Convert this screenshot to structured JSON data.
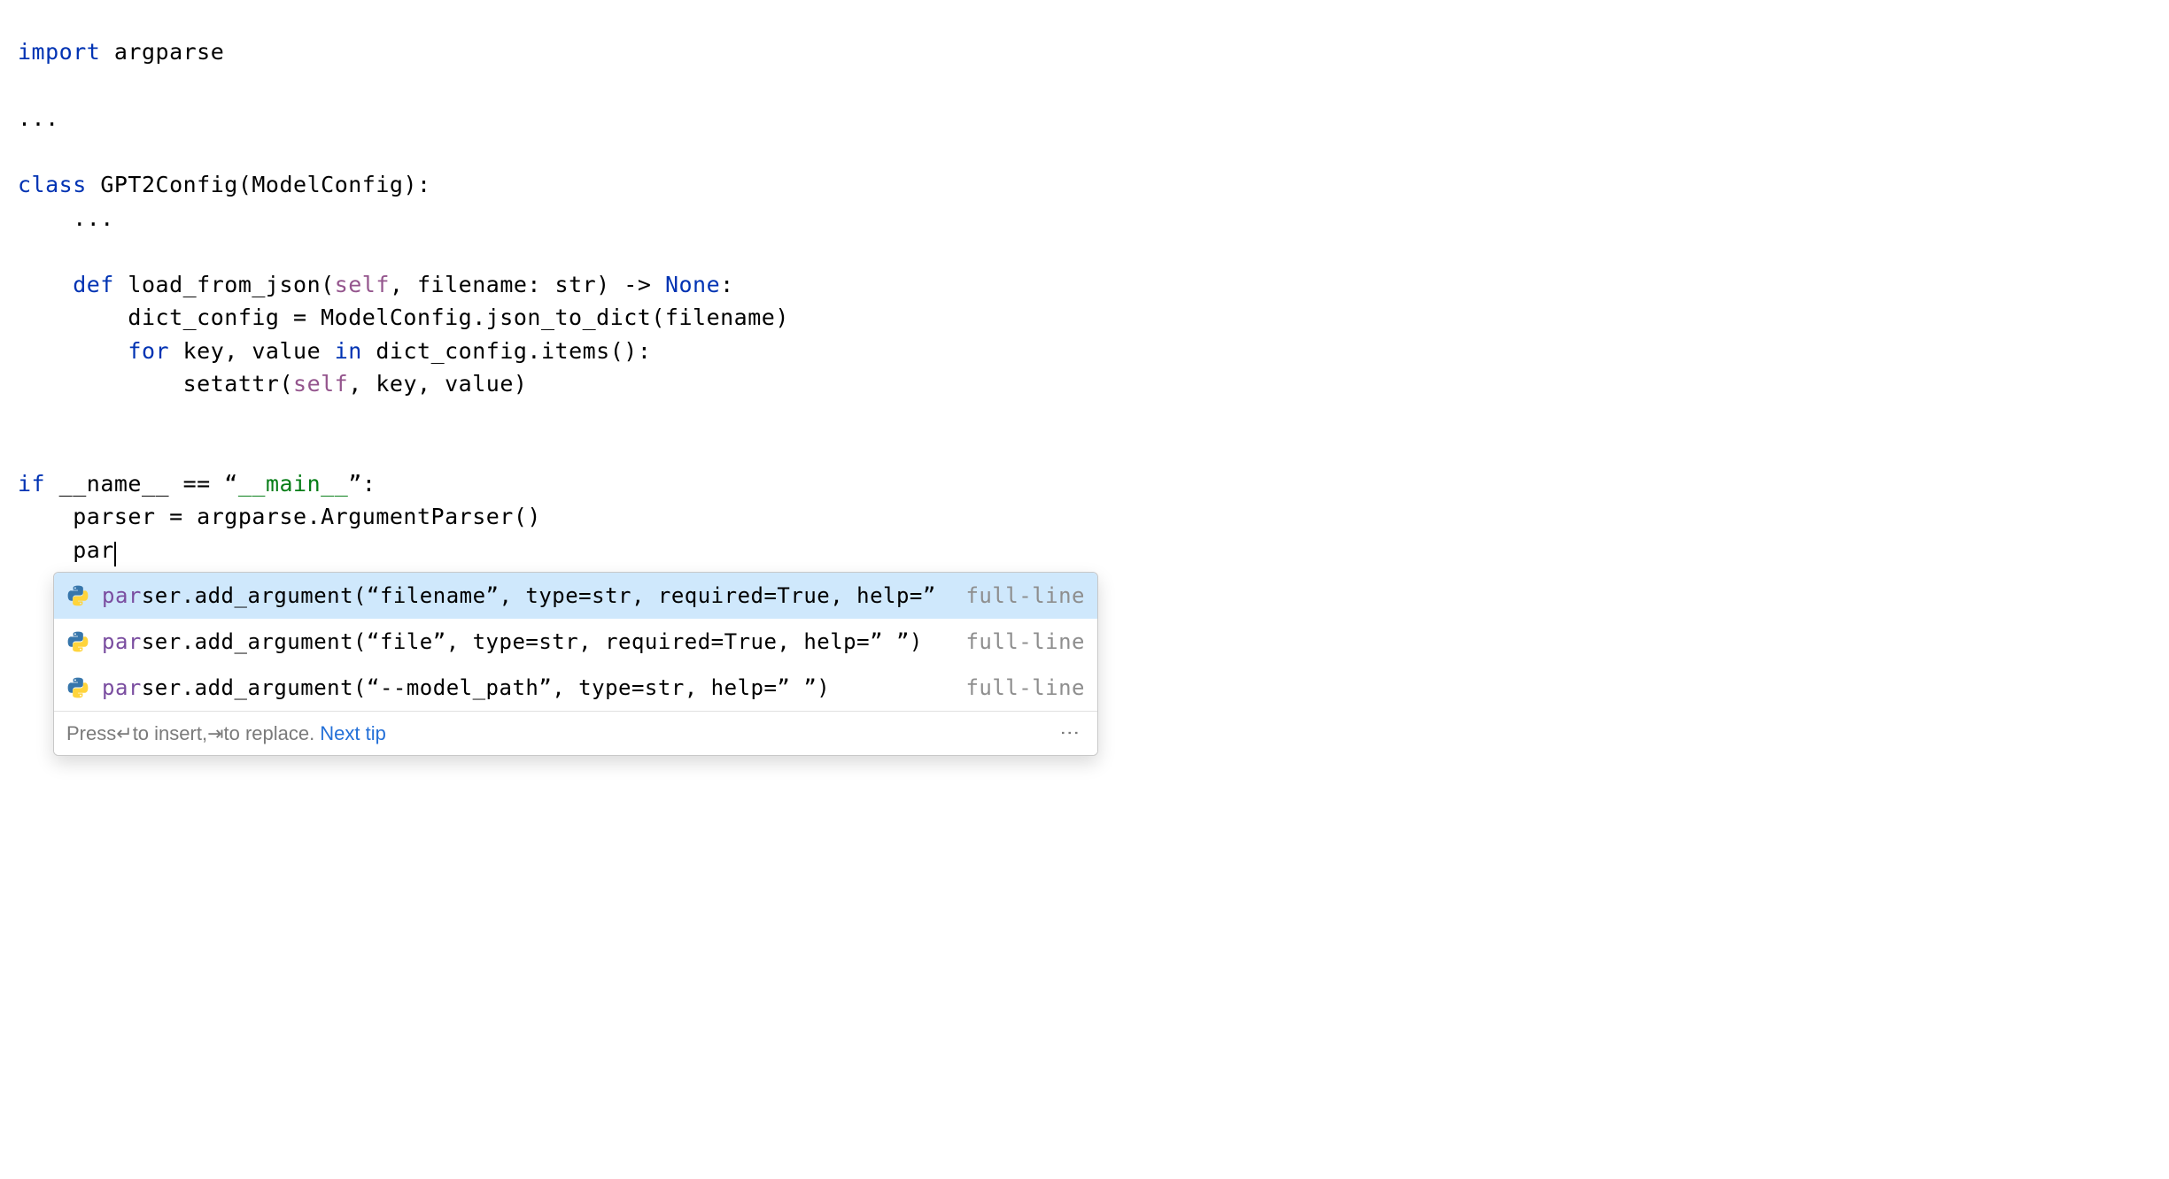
{
  "code": {
    "line1_import": "import",
    "line1_module": " argparse",
    "line3_ellipsis": "...",
    "line5_class": "class",
    "line5_rest": " GPT2Config(ModelConfig):",
    "line6_ellipsis": "    ...",
    "line8_def": "    def",
    "line8_name": " load_from_json(",
    "line8_self": "self",
    "line8_rest1": ", filename: str) -> ",
    "line8_none": "None",
    "line8_rest2": ":",
    "line9": "        dict_config = ModelConfig.json_to_dict(filename)",
    "line10_for": "        for",
    "line10_rest1": " key, value ",
    "line10_in": "in",
    "line10_rest2": " dict_config.items():",
    "line11_pre": "            setattr(",
    "line11_self": "self",
    "line11_rest": ", key, value)",
    "line14_if": "if",
    "line14_rest1": " __name__ == ",
    "line14_q1": "“",
    "line14_str": "__main__",
    "line14_q2": "”",
    "line14_colon": ":",
    "line15": "    parser = argparse.ArgumentParser()",
    "line16_prefix": "    par"
  },
  "suggestions": [
    {
      "match": "par",
      "rest": "ser.add_argument(“filename”, type=str, required=True, help=” ”)",
      "type": "full-line",
      "selected": true
    },
    {
      "match": "par",
      "rest": "ser.add_argument(“file”, type=str, required=True, help=” ”)",
      "type": "full-line",
      "selected": false
    },
    {
      "match": "par",
      "rest": "ser.add_argument(“--model_path”, type=str, help=” ”)",
      "type": "full-line",
      "selected": false
    }
  ],
  "footer": {
    "press": "Press ",
    "enter_symbol": "↵",
    "to_insert": " to insert, ",
    "tab_symbol": "⇥",
    "to_replace": " to replace. ",
    "next_tip": "Next tip"
  }
}
